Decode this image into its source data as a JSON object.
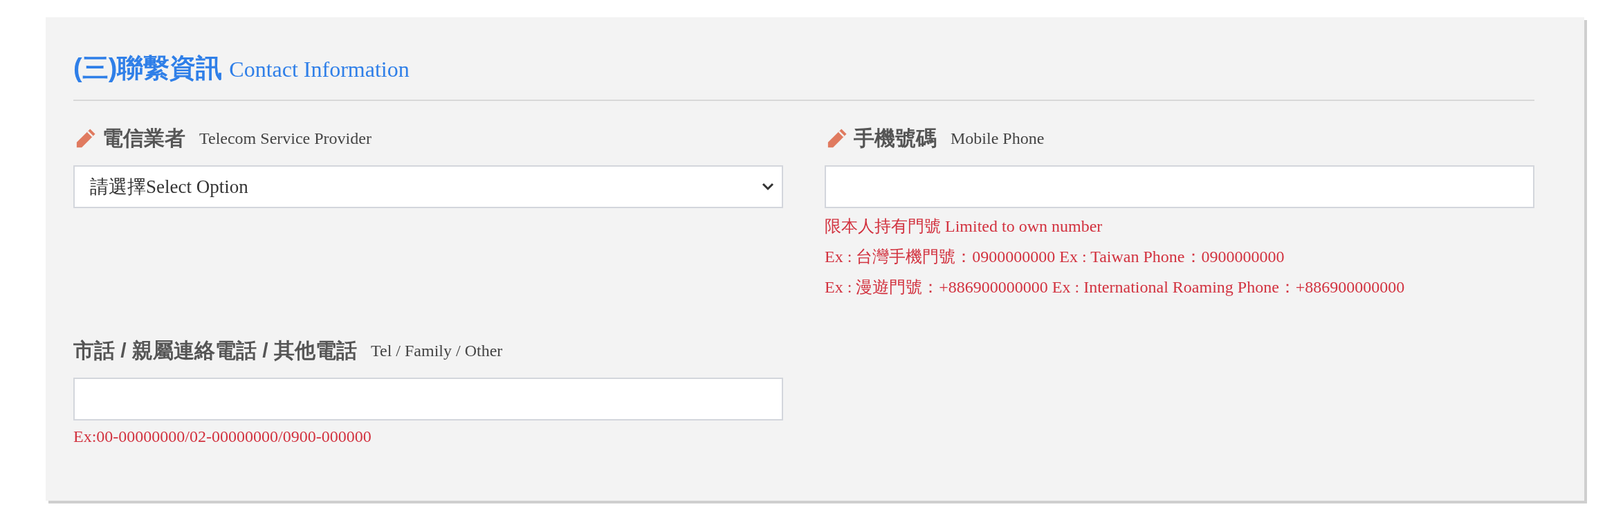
{
  "section": {
    "title": "(三)聯繫資訊",
    "subtitle": "Contact Information"
  },
  "fields": [
    {
      "kind": "select",
      "required": true,
      "label": "電信業者",
      "label_en": "Telecom Service Provider",
      "value": "請選擇Select Option"
    },
    {
      "kind": "text",
      "required": true,
      "label": "手機號碼",
      "label_en": "Mobile Phone",
      "notes": [
        "限本人持有門號 Limited to own number",
        "Ex : 台灣手機門號：0900000000 Ex : Taiwan Phone：0900000000",
        "Ex : 漫遊門號：+886900000000 Ex : International Roaming Phone：+886900000000"
      ]
    },
    {
      "kind": "text",
      "required": false,
      "label": "市話 / 親屬連絡電話 / 其他電話",
      "label_en": "Tel / Family / Other",
      "notes": [
        "Ex:00-00000000/02-00000000/0900-000000"
      ]
    }
  ]
}
